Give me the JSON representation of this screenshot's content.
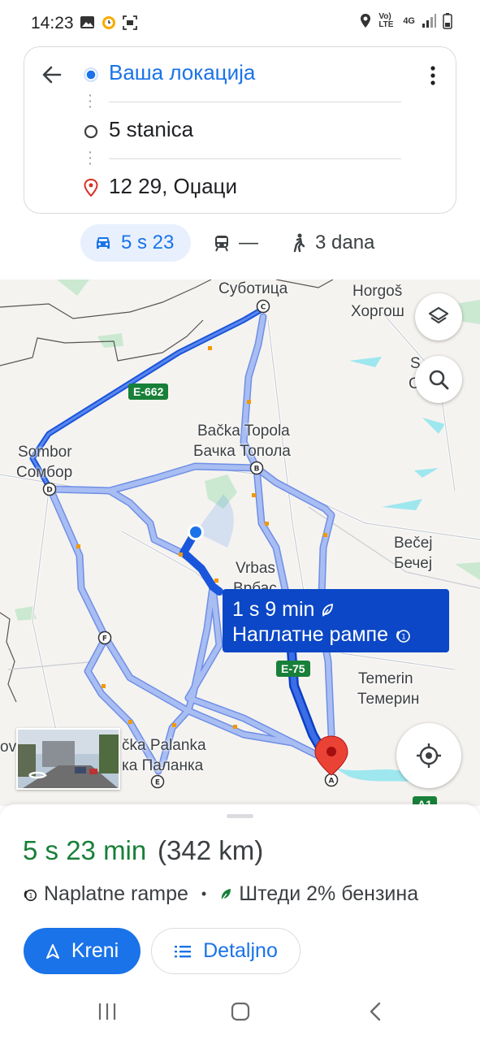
{
  "status_bar": {
    "time": "14:23",
    "network": "Vo) LTE",
    "signal": "4G"
  },
  "search": {
    "back_icon": "arrow-back-icon",
    "origin": "Ваша локација",
    "stop": "5 stanica",
    "destination": "12 29, Оџаци",
    "more_icon": "more-vert-icon"
  },
  "modes": {
    "car": "5 s 23",
    "transit": "—",
    "walk": "3 dana"
  },
  "map": {
    "cities": {
      "subotica": "Суботица",
      "horgos_lat": "Horgoš",
      "horgos_cyr": "Хоргош",
      "backa_topola_lat": "Bačka Topola",
      "backa_topola_cyr": "Бачка Топола",
      "sombor_lat": "Sombor",
      "sombor_cyr": "Сомбор",
      "becej_lat": "Bečej",
      "becej_cyr": "Бечеј",
      "vrbas_lat": "Vrbas",
      "vrbas_cyr": "Врбас",
      "temerin_lat": "Temerin",
      "temerin_cyr": "Темерин",
      "palanka_lat": "čka Palanka",
      "palanka_cyr": "ка Паланка",
      "s_partial_1": "S",
      "s_partial_2": "C",
      "ov_partial": "ov"
    },
    "roads": {
      "e662": "E-662",
      "e75": "E-75",
      "a1": "A1"
    },
    "waypoints": [
      "A",
      "B",
      "C",
      "D",
      "E",
      "F"
    ],
    "callout": {
      "time": "1 s 9 min",
      "tolls": "Наплатне рампе"
    },
    "colors": {
      "route_primary": "#1a56db",
      "route_alt": "#a8bdf2",
      "callout": "#0b47c6"
    }
  },
  "sheet": {
    "duration": "5 s 23 min",
    "distance": "(342 km)",
    "tolls": "Naplatne rampe",
    "separator": "•",
    "fuel": "Штеди 2% бензина",
    "start_button": "Kreni",
    "details_button": "Detaljno"
  }
}
